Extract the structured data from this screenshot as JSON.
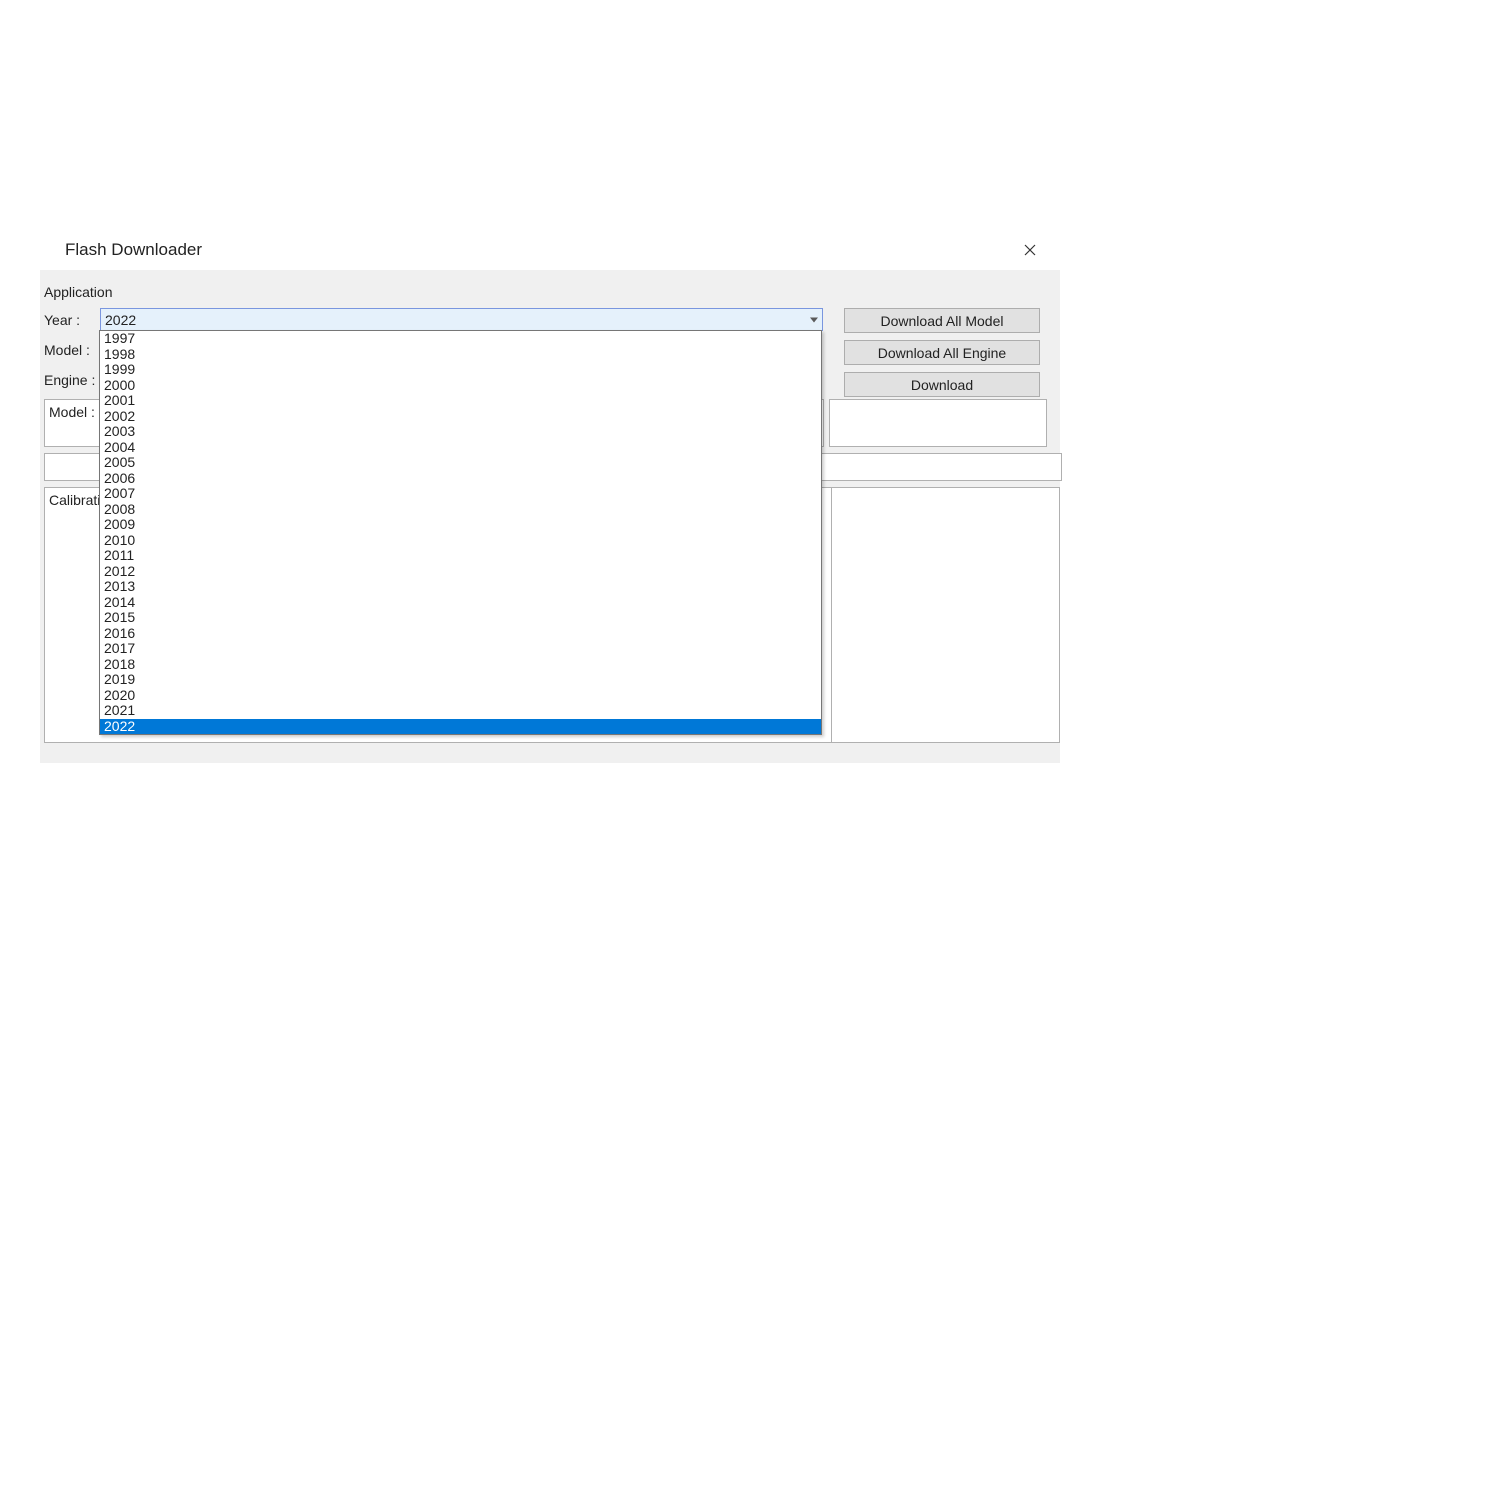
{
  "titlebar": {
    "title": "Flash Downloader"
  },
  "section": {
    "label": "Application"
  },
  "form": {
    "year_label": "Year :",
    "model_label": "Model :",
    "engine_label": "Engine :",
    "year_value": "2022",
    "year_options": [
      "1997",
      "1998",
      "1999",
      "2000",
      "2001",
      "2002",
      "2003",
      "2004",
      "2005",
      "2006",
      "2007",
      "2008",
      "2009",
      "2010",
      "2011",
      "2012",
      "2013",
      "2014",
      "2015",
      "2016",
      "2017",
      "2018",
      "2019",
      "2020",
      "2021",
      "2022"
    ],
    "year_selected": "2022"
  },
  "buttons": {
    "download_all_model": "Download All Model",
    "download_all_engine": "Download All Engine",
    "download": "Download"
  },
  "panels": {
    "model_line": "Model : L",
    "calibration_label": "Calibration"
  }
}
